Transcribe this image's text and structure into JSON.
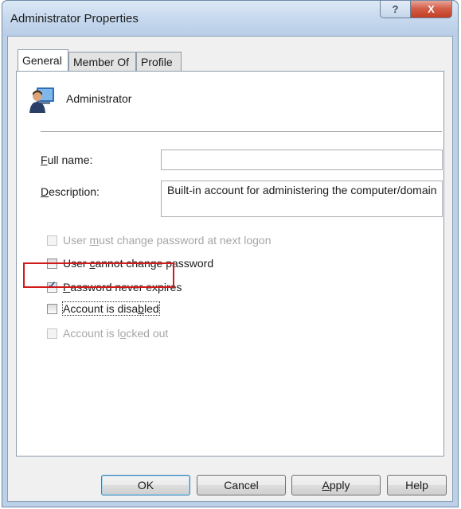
{
  "window": {
    "title": "Administrator Properties",
    "help_glyph": "?",
    "close_glyph": "X"
  },
  "tabs": [
    {
      "label": "General",
      "active": true
    },
    {
      "label": "Member Of",
      "active": false
    },
    {
      "label": "Profile",
      "active": false
    }
  ],
  "general": {
    "user_icon": "user-icon",
    "user_name": "Administrator",
    "full_name": {
      "label_mnemonic": "F",
      "label_rest": "ull name:",
      "value": ""
    },
    "description": {
      "label_mnemonic": "D",
      "label_rest": "escription:",
      "value": "Built-in account for administering the computer/domain"
    },
    "options": [
      {
        "pre": "User ",
        "mnemonic": "m",
        "post": "ust change password at next logon",
        "checked": false,
        "enabled": false
      },
      {
        "pre": "User ",
        "mnemonic": "c",
        "post": "annot change password",
        "checked": false,
        "enabled": true
      },
      {
        "pre": "",
        "mnemonic": "P",
        "post": "assword never expires",
        "checked": true,
        "enabled": true
      },
      {
        "pre": "Account is disa",
        "mnemonic": "b",
        "post": "led",
        "checked": false,
        "enabled": true
      },
      {
        "pre": "Account is l",
        "mnemonic": "o",
        "post": "cked out",
        "checked": false,
        "enabled": false
      }
    ],
    "check_glyph": "✓",
    "highlight_color": "#d11a1a"
  },
  "buttons": {
    "ok": "OK",
    "cancel": "Cancel",
    "apply_mnemonic": "A",
    "apply_rest": "pply",
    "help": "Help"
  }
}
